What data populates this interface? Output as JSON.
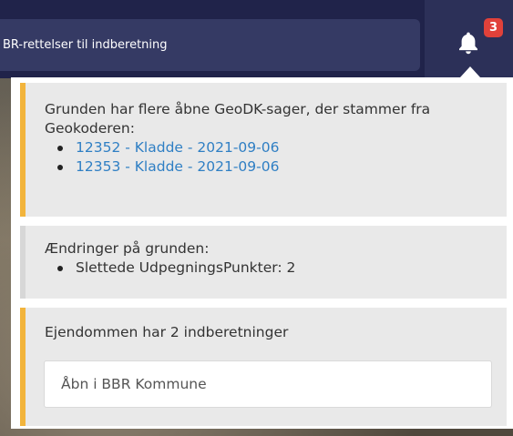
{
  "header": {
    "search_text": "BR-rettelser til indberetning",
    "notification_count": "3"
  },
  "notifications": {
    "geodk": {
      "text": "Grunden har flere åbne GeoDK-sager, der stammer fra Geokoderen:",
      "cases": [
        "12352 - Kladde - 2021-09-06",
        "12353 - Kladde - 2021-09-06"
      ],
      "accent_color": "#f2b43c"
    },
    "changes": {
      "text": "Ændringer på grunden:",
      "items": [
        "Slettede UdpegningsPunkter: 2"
      ]
    },
    "reports": {
      "text": "Ejendommen har 2 indberetninger",
      "button_label": "Åbn i BBR Kommune",
      "accent_color": "#f2b43c"
    }
  },
  "colors": {
    "topbar": "#20234a",
    "badge": "#e1413a",
    "link": "#2f7fc4"
  },
  "icons": {
    "bell": "bell-icon"
  }
}
